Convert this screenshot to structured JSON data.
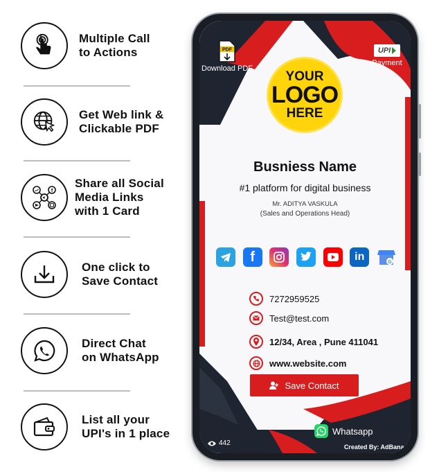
{
  "features": [
    {
      "label": "Multiple Call\nto Actions",
      "icon": "tap-hand-icon"
    },
    {
      "label": "Get Web link &\nClickable PDF",
      "icon": "globe-cursor-icon"
    },
    {
      "label": "Share all Social\nMedia Links\nwith 1 Card",
      "icon": "social-share-icon"
    },
    {
      "label": "One click to\nSave Contact",
      "icon": "download-icon"
    },
    {
      "label": "Direct Chat\non WhatsApp",
      "icon": "whatsapp-icon"
    },
    {
      "label": "List all your\nUPI's in 1 place",
      "icon": "wallet-icon"
    }
  ],
  "card": {
    "download_pdf": {
      "badge": "PDF",
      "label": "Download PDF"
    },
    "payment": {
      "badge": "UPI",
      "label": "Payment"
    },
    "logo": {
      "line1": "YOUR",
      "line2": "LOGO",
      "line3": "HERE"
    },
    "business_name": "Busniess Name",
    "tagline": "#1 platform for digital business",
    "person_name": "Mr. ADITYA VASKULA",
    "person_role": "(Sales and Operations Head)",
    "socials": [
      {
        "name": "telegram-icon",
        "color": "#2aa3e0",
        "glyph": "➤"
      },
      {
        "name": "facebook-icon",
        "color": "#1877f2",
        "glyph": "f"
      },
      {
        "name": "instagram-icon",
        "color": "#c13584",
        "glyph": "◎"
      },
      {
        "name": "twitter-icon",
        "color": "#1da1f2",
        "glyph": "🐦"
      },
      {
        "name": "youtube-icon",
        "color": "#ff0000",
        "glyph": "▶"
      },
      {
        "name": "linkedin-icon",
        "color": "#0a66c2",
        "glyph": "in"
      },
      {
        "name": "google-business-icon",
        "color": "#4285f4",
        "glyph": "G"
      }
    ],
    "contacts": {
      "phone": "7272959525",
      "email": "Test@test.com",
      "address": "12/34, Area , Pune 411041",
      "website": "www.website.com"
    },
    "save_contact": "Save Contact",
    "whatsapp": "Whatsapp",
    "views": "442",
    "created_by": "Created By: AdBanao"
  },
  "colors": {
    "accent_red": "#d71d1d",
    "dark": "#1f2530",
    "logo_yellow": "#ffd40a",
    "whatsapp_green": "#25d366"
  }
}
